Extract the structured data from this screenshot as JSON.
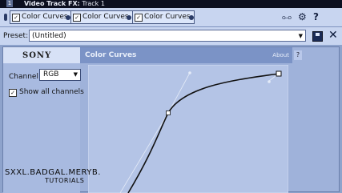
{
  "window": {
    "track_num": "1",
    "title_bold": "Video Track FX:",
    "title_rest": " Track 1"
  },
  "plugin_chain": {
    "plugins": [
      {
        "label": "Color Curves",
        "checked": true
      },
      {
        "label": "Color Curves",
        "checked": true
      },
      {
        "label": "Color Curves",
        "checked": true
      }
    ],
    "icons": [
      "chain-plugins-icon",
      "plugin-chooser-icon",
      "help-icon"
    ],
    "help_glyph": "?"
  },
  "preset": {
    "label": "Preset:",
    "value": "(Untitled)",
    "icons": [
      "save-preset-icon",
      "delete-preset-icon"
    ]
  },
  "panel": {
    "brand": "SONY",
    "plugin_name": "Color Curves",
    "about": "About",
    "help_glyph": "?",
    "channel_label": "Channel:",
    "channel_value": "RGB",
    "show_all_label": "Show all channels",
    "show_all_checked": true
  },
  "watermark": {
    "line1": "SXXL.BADGAL.MERYB.",
    "line2": "TUTORIALS"
  }
}
